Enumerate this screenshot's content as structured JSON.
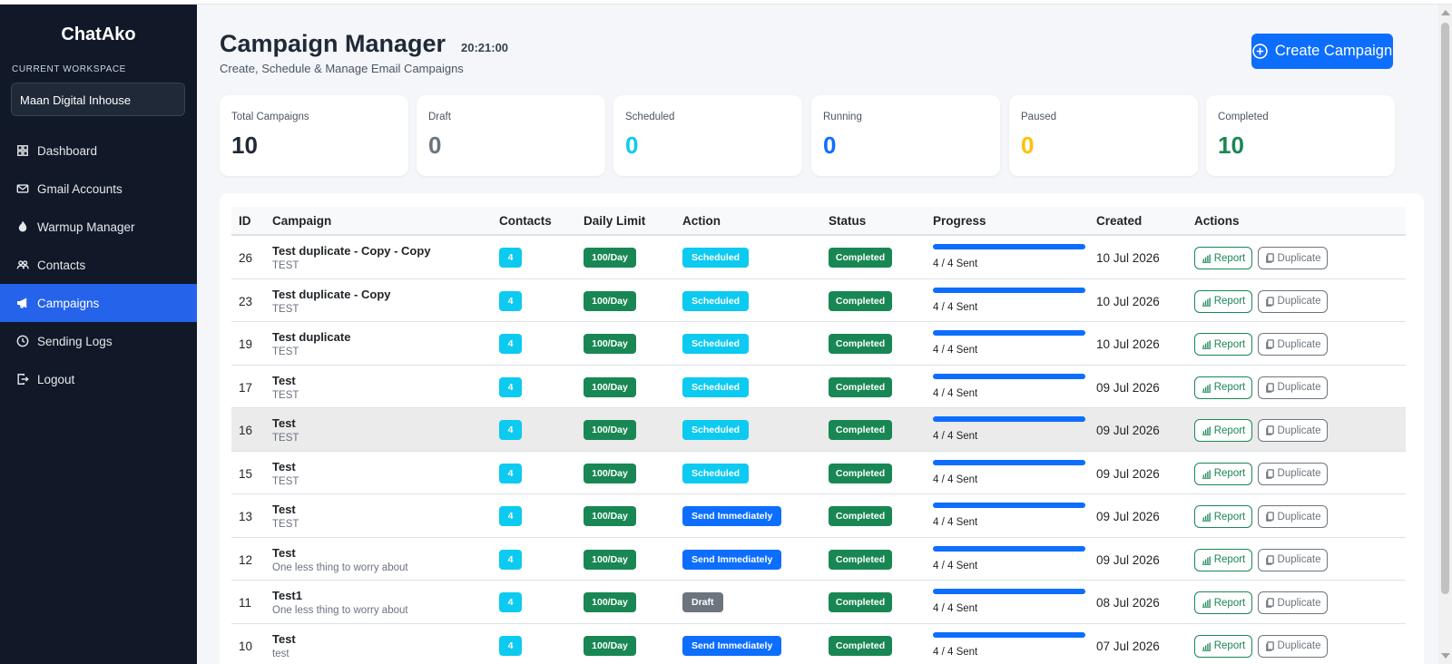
{
  "app": {
    "brand": "ChatAko"
  },
  "sidebar": {
    "workspace_label": "CURRENT WORKSPACE",
    "workspace_value": "Maan Digital Inhouse",
    "items": [
      {
        "label": "Dashboard",
        "icon": "grid-icon"
      },
      {
        "label": "Gmail Accounts",
        "icon": "envelope-icon"
      },
      {
        "label": "Warmup Manager",
        "icon": "fire-icon"
      },
      {
        "label": "Contacts",
        "icon": "people-icon"
      },
      {
        "label": "Campaigns",
        "icon": "megaphone-icon",
        "active": true
      },
      {
        "label": "Sending Logs",
        "icon": "clock-icon"
      },
      {
        "label": "Logout",
        "icon": "logout-icon"
      }
    ]
  },
  "header": {
    "title": "Campaign Manager",
    "clock": "20:21:00",
    "subtitle": "Create, Schedule & Manage Email Campaigns",
    "create_button": "Create Campaign"
  },
  "stats": [
    {
      "label": "Total Campaigns",
      "value": "10",
      "color": "#1f2937"
    },
    {
      "label": "Draft",
      "value": "0",
      "color": "#6c757d"
    },
    {
      "label": "Scheduled",
      "value": "0",
      "color": "#0dcaf0"
    },
    {
      "label": "Running",
      "value": "0",
      "color": "#0d6efd"
    },
    {
      "label": "Paused",
      "value": "0",
      "color": "#ffc107"
    },
    {
      "label": "Completed",
      "value": "10",
      "color": "#198754"
    }
  ],
  "table": {
    "columns": [
      "ID",
      "Campaign",
      "Contacts",
      "Daily Limit",
      "Action",
      "Status",
      "Progress",
      "Created",
      "Actions"
    ],
    "report_label": "Report",
    "duplicate_label": "Duplicate",
    "rows": [
      {
        "id": "26",
        "name": "Test duplicate - Copy - Copy",
        "sub": "TEST",
        "contacts": "4",
        "limit": "100/Day",
        "action": "Scheduled",
        "status": "Completed",
        "progress": 1.0,
        "progress_text": "4 / 4 Sent",
        "created": "10 Jul 2026"
      },
      {
        "id": "23",
        "name": "Test duplicate - Copy",
        "sub": "TEST",
        "contacts": "4",
        "limit": "100/Day",
        "action": "Scheduled",
        "status": "Completed",
        "progress": 1.0,
        "progress_text": "4 / 4 Sent",
        "created": "10 Jul 2026"
      },
      {
        "id": "19",
        "name": "Test duplicate",
        "sub": "TEST",
        "contacts": "4",
        "limit": "100/Day",
        "action": "Scheduled",
        "status": "Completed",
        "progress": 1.0,
        "progress_text": "4 / 4 Sent",
        "created": "10 Jul 2026"
      },
      {
        "id": "17",
        "name": "Test",
        "sub": "TEST",
        "contacts": "4",
        "limit": "100/Day",
        "action": "Scheduled",
        "status": "Completed",
        "progress": 1.0,
        "progress_text": "4 / 4 Sent",
        "created": "09 Jul 2026"
      },
      {
        "id": "16",
        "name": "Test",
        "sub": "TEST",
        "contacts": "4",
        "limit": "100/Day",
        "action": "Scheduled",
        "status": "Completed",
        "progress": 1.0,
        "progress_text": "4 / 4 Sent",
        "created": "09 Jul 2026",
        "highlight": true
      },
      {
        "id": "15",
        "name": "Test",
        "sub": "TEST",
        "contacts": "4",
        "limit": "100/Day",
        "action": "Scheduled",
        "status": "Completed",
        "progress": 1.0,
        "progress_text": "4 / 4 Sent",
        "created": "09 Jul 2026"
      },
      {
        "id": "13",
        "name": "Test",
        "sub": "TEST",
        "contacts": "4",
        "limit": "100/Day",
        "action": "Send Immediately",
        "status": "Completed",
        "progress": 1.0,
        "progress_text": "4 / 4 Sent",
        "created": "09 Jul 2026"
      },
      {
        "id": "12",
        "name": "Test",
        "sub": "One less thing to worry about",
        "contacts": "4",
        "limit": "100/Day",
        "action": "Send Immediately",
        "status": "Completed",
        "progress": 1.0,
        "progress_text": "4 / 4 Sent",
        "created": "09 Jul 2026"
      },
      {
        "id": "11",
        "name": "Test1",
        "sub": "One less thing to worry about",
        "contacts": "4",
        "limit": "100/Day",
        "action": "Draft",
        "status": "Completed",
        "progress": 1.0,
        "progress_text": "4 / 4 Sent",
        "created": "08 Jul 2026"
      },
      {
        "id": "10",
        "name": "Test",
        "sub": "test",
        "contacts": "4",
        "limit": "100/Day",
        "action": "Send Immediately",
        "status": "Completed",
        "progress": 1.0,
        "progress_text": "4 / 4 Sent",
        "created": "07 Jul 2026"
      }
    ]
  }
}
